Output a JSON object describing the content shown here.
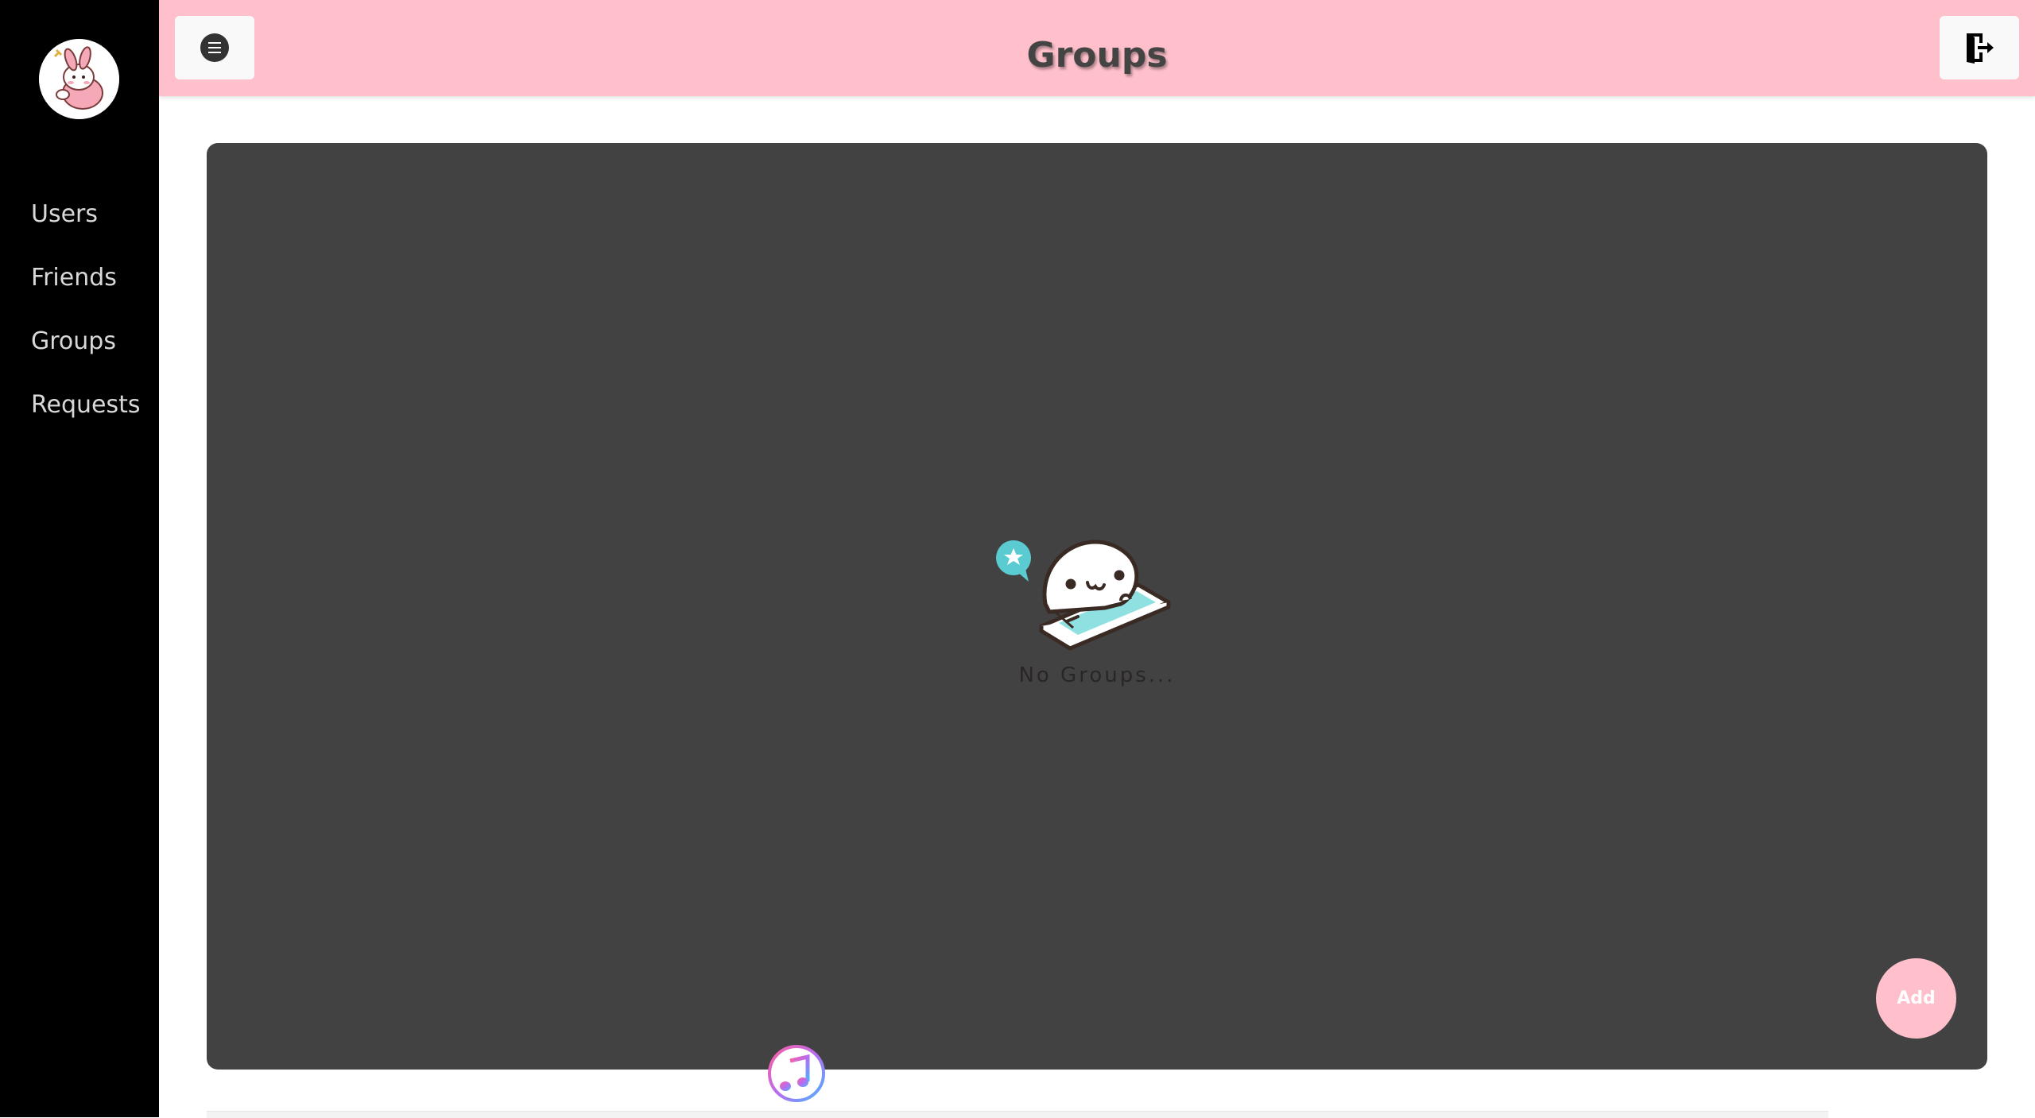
{
  "sidebar": {
    "items": [
      {
        "label": "Users"
      },
      {
        "label": "Friends"
      },
      {
        "label": "Groups"
      },
      {
        "label": "Requests"
      }
    ]
  },
  "header": {
    "title": "Groups",
    "menu_icon": "hamburger-circle-icon",
    "logout_icon": "exit-door-icon"
  },
  "main": {
    "empty_state": {
      "text": "No Groups...",
      "illustration": "seal-on-phone-illustration"
    },
    "add_button_label": "Add"
  },
  "dock": {
    "icon": "music-note-app-icon"
  },
  "colors": {
    "sidebar_bg": "#000000",
    "header_bg": "#ffc0cb",
    "panel_bg": "#424242",
    "accent": "#ffc0cb"
  }
}
